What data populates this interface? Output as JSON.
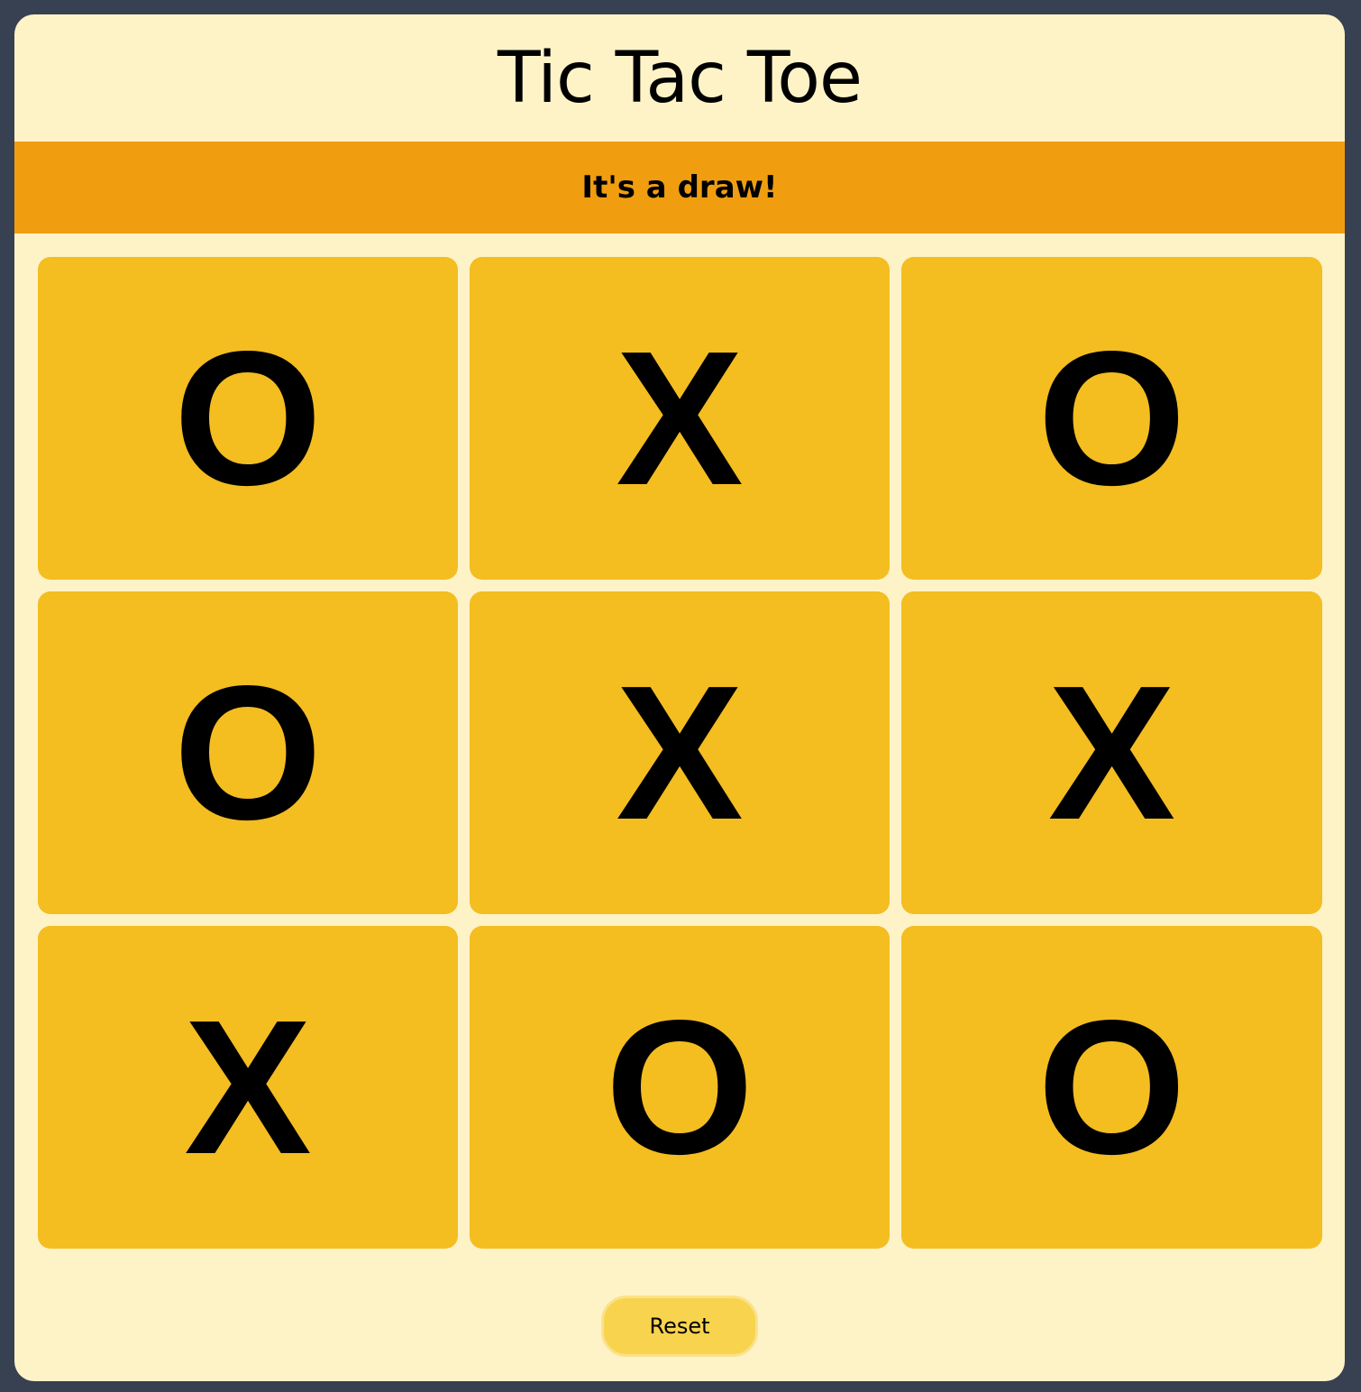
{
  "app": {
    "title": "Tic Tac Toe",
    "status": "It's a draw!",
    "reset_label": "Reset"
  },
  "board": {
    "cells": [
      "O",
      "X",
      "O",
      "O",
      "X",
      "X",
      "X",
      "O",
      "O"
    ]
  },
  "colors": {
    "page_background": "#374151",
    "panel_background": "#fef3c7",
    "status_background": "#f09e10",
    "cell_background": "#f4bd20",
    "reset_background": "#f8d34e"
  }
}
